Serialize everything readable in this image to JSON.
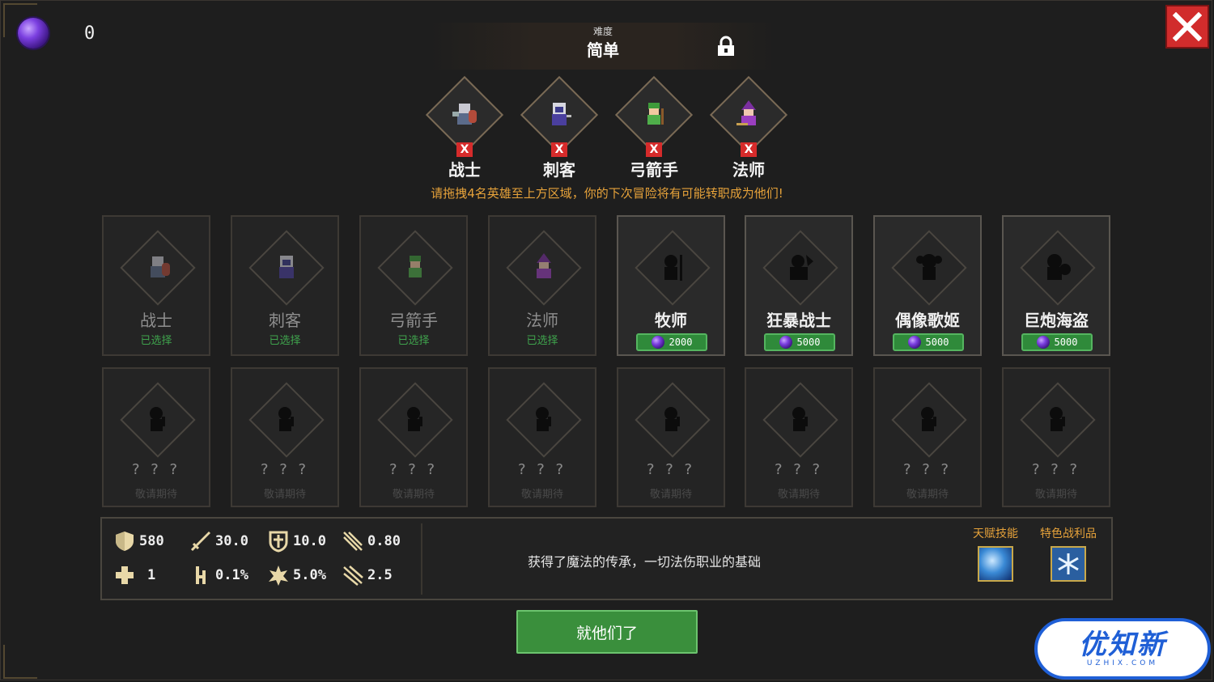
{
  "top": {
    "currency_value": "0",
    "difficulty_label": "难度",
    "difficulty_value": "简单"
  },
  "selected_heroes": [
    {
      "name": "战士",
      "remove": "X",
      "icon": "warrior-icon"
    },
    {
      "name": "刺客",
      "remove": "X",
      "icon": "assassin-icon"
    },
    {
      "name": "弓箭手",
      "remove": "X",
      "icon": "archer-icon"
    },
    {
      "name": "法师",
      "remove": "X",
      "icon": "mage-icon"
    }
  ],
  "hint": "请拖拽4名英雄至上方区域，你的下次冒险将有可能转职成为他们!",
  "heroes_row1": [
    {
      "name": "战士",
      "status": "已选择"
    },
    {
      "name": "刺客",
      "status": "已选择"
    },
    {
      "name": "弓箭手",
      "status": "已选择"
    },
    {
      "name": "法师",
      "status": "已选择"
    },
    {
      "name": "牧师",
      "price": "2000"
    },
    {
      "name": "狂暴战士",
      "price": "5000"
    },
    {
      "name": "偶像歌姬",
      "price": "5000"
    },
    {
      "name": "巨炮海盗",
      "price": "5000"
    }
  ],
  "heroes_row2": {
    "name": "? ? ?",
    "status": "敬请期待",
    "count": 8
  },
  "stats": {
    "hp": "580",
    "attack": "30.0",
    "armor": "10.0",
    "atk_speed": "0.80",
    "regen": "1",
    "lifesteal": "0.1%",
    "crit": "5.0%",
    "range": "2.5"
  },
  "description": "获得了魔法的传承，一切法伤职业的基础",
  "talent_label": "天赋技能",
  "loot_label": "特色战利品",
  "confirm_button": "就他们了",
  "watermark": {
    "big": "优知新",
    "small": "UZHIX.COM"
  },
  "colors": {
    "accent_green": "#3a8f3c",
    "hint_orange": "#e6a23a",
    "close_red": "#d12c2c"
  }
}
